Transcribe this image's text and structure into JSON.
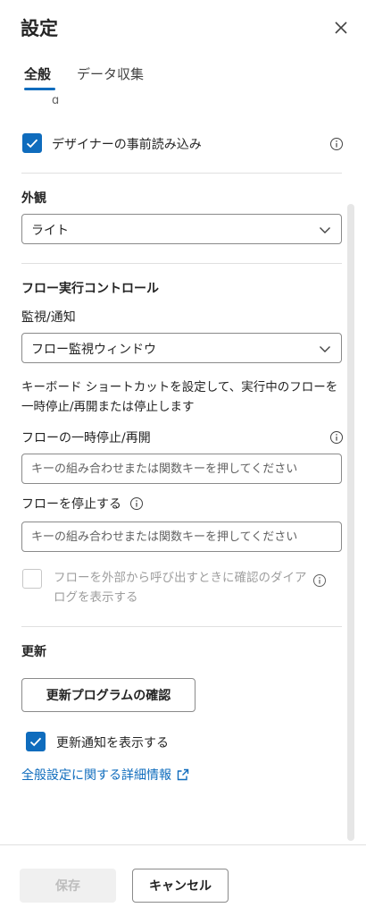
{
  "header": {
    "title": "設定",
    "close_icon": "close-icon"
  },
  "tabs": [
    {
      "label": "全般",
      "active": true
    },
    {
      "label": "データ収集",
      "active": false
    }
  ],
  "general": {
    "clipped_text": "g",
    "designer_preload": {
      "label": "デザイナーの事前読み込み",
      "checked": true
    },
    "appearance": {
      "title": "外観",
      "selected": "ライト"
    },
    "flow_run": {
      "title": "フロー実行コントロール",
      "monitor_label": "監視/通知",
      "monitor_selected": "フロー監視ウィンドウ",
      "shortcut_desc": "キーボード ショートカットを設定して、実行中のフローを一時停止/再開または停止します",
      "pause_label": "フローの一時停止/再開",
      "pause_placeholder": "キーの組み合わせまたは関数キーを押してください",
      "stop_label": "フローを停止する",
      "stop_placeholder": "キーの組み合わせまたは関数キーを押してください",
      "confirm_external": {
        "label": "フローを外部から呼び出すときに確認のダイアログを表示する",
        "checked": false,
        "disabled": true
      }
    },
    "updates": {
      "title": "更新",
      "check_button": "更新プログラムの確認",
      "show_notifications": {
        "label": "更新通知を表示する",
        "checked": true
      },
      "more_info_link": "全般設定に関する詳細情報"
    }
  },
  "footer": {
    "save_label": "保存",
    "cancel_label": "キャンセル"
  },
  "colors": {
    "accent": "#0f6cbd",
    "divider": "#e0e0e0",
    "disabled": "#9e9e9e"
  }
}
